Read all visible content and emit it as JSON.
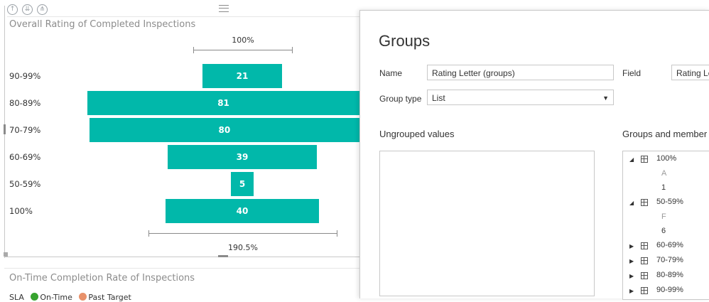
{
  "visual": {
    "title": "Overall Rating of Completed Inspections",
    "top_bracket_label": "100%",
    "bottom_bracket_label": "190.5%",
    "rows": [
      {
        "label": "90-99%",
        "value": "21"
      },
      {
        "label": "80-89%",
        "value": "81"
      },
      {
        "label": "70-79%",
        "value": "80"
      },
      {
        "label": "60-69%",
        "value": "39"
      },
      {
        "label": "50-59%",
        "value": "5"
      },
      {
        "label": "100%",
        "value": "40"
      }
    ],
    "bar_color": "#01b8aa"
  },
  "visual2": {
    "title": "On-Time Completion Rate of Inspections",
    "legend_prefix": "SLA",
    "legend_items": [
      {
        "label": "On-Time",
        "color": "#37a32f"
      },
      {
        "label": "Past Target",
        "color": "#e8916a"
      }
    ]
  },
  "header_icons": [
    "up-arrow-icon",
    "double-down-arrow-icon",
    "expand-level-icon"
  ],
  "dialog": {
    "title": "Groups",
    "name_label": "Name",
    "name_value": "Rating Letter (groups)",
    "field_label": "Field",
    "field_value": "Rating Le",
    "group_type_label": "Group type",
    "group_type_value": "List",
    "ungrouped_heading": "Ungrouped values",
    "groups_heading": "Groups and member",
    "groups": [
      {
        "name": "100%",
        "expanded": true,
        "members": [
          "A",
          "1"
        ]
      },
      {
        "name": "50-59%",
        "expanded": true,
        "members": [
          "F",
          "6"
        ]
      },
      {
        "name": "60-69%",
        "expanded": false,
        "members": []
      },
      {
        "name": "70-79%",
        "expanded": false,
        "members": []
      },
      {
        "name": "80-89%",
        "expanded": false,
        "members": []
      },
      {
        "name": "90-99%",
        "expanded": false,
        "members": []
      }
    ]
  }
}
